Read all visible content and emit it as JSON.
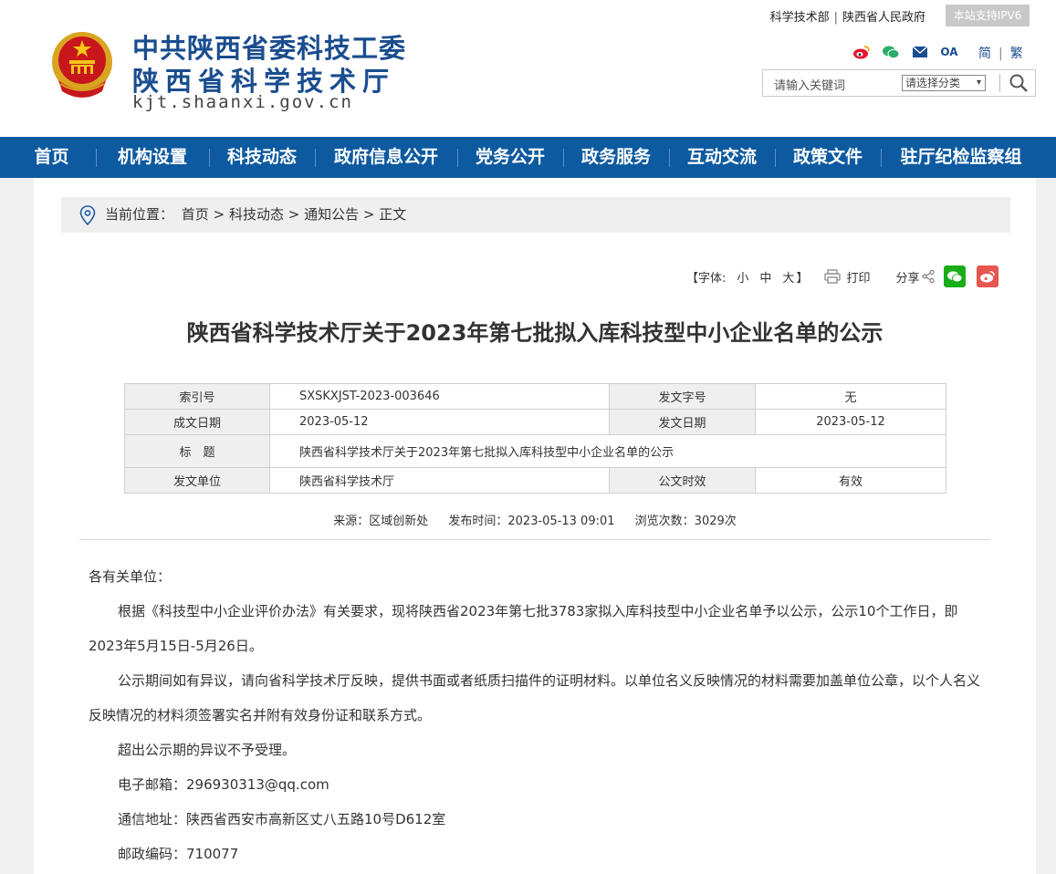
{
  "header": {
    "name_line1": "中共陕西省委科技工委",
    "name_line2": "陕西省科学技术厅",
    "url": "kjt.shaanxi.gov.cn",
    "top_links": [
      "科学技术部",
      "陕西省人民政府"
    ],
    "ipv6_badge": "本站支持IPV6",
    "lang": [
      "简",
      "繁"
    ],
    "social_icons": [
      "weibo-icon",
      "wechat-icon",
      "mail-icon",
      "oa-icon"
    ],
    "oa_label": "OA",
    "search": {
      "placeholder": "请输入关键词",
      "category": "请选择分类"
    }
  },
  "nav": [
    "首页",
    "机构设置",
    "科技动态",
    "政府信息公开",
    "党务公开",
    "政务服务",
    "互动交流",
    "政策文件",
    "驻厅纪检监察组"
  ],
  "breadcrumb": {
    "label": "当前位置：",
    "path": [
      "首页",
      "科技动态",
      "通知公告",
      "正文"
    ],
    "separator": ">"
  },
  "tools": {
    "font_label": "【字体:",
    "font_small": "小",
    "font_medium": "中",
    "font_large": "大",
    "font_close": "】",
    "print": "打印",
    "share": "分享"
  },
  "article": {
    "title": "陕西省科学技术厅关于2023年第七批拟入库科技型中小企业名单的公示",
    "meta": {
      "index_key": "索引号",
      "index_val": "SXSKXJST-2023-003646",
      "docno_key": "发文字号",
      "docno_val": "无",
      "created_key": "成文日期",
      "created_val": "2023-05-12",
      "issued_key": "发文日期",
      "issued_val": "2023-05-12",
      "title_key": "标　题",
      "title_val": "陕西省科学技术厅关于2023年第七批拟入库科技型中小企业名单的公示",
      "unit_key": "发文单位",
      "unit_val": "陕西省科学技术厅",
      "validity_key": "公文时效",
      "validity_val": "有效"
    },
    "source": "来源：区域创新处",
    "publish_time": "发布时间：2023-05-13 09:01",
    "views": "浏览次数：3029次",
    "paragraphs": [
      "各有关单位：",
      "根据《科技型中小企业评价办法》有关要求，现将陕西省2023年第七批3783家拟入库科技型中小企业名单予以公示，公示10个工作日，即2023年5月15日-5月26日。",
      "公示期间如有异议，请向省科学技术厅反映，提供书面或者纸质扫描件的证明材料。以单位名义反映情况的材料需要加盖单位公章，以个人名义反映情况的材料须签署实名并附有效身份证和联系方式。",
      "超出公示期的异议不予受理。",
      "电子邮箱：296930313@qq.com",
      "通信地址：陕西省西安市高新区丈八五路10号D612室",
      "邮政编码：710077"
    ]
  },
  "colors": {
    "brand_blue": "#0d5aa0",
    "title_blue": "#1a4d8f",
    "wechat_green": "#1aad19",
    "weibo_red": "#e6564e"
  }
}
